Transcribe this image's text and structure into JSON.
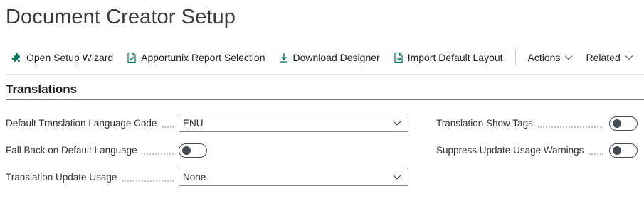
{
  "page": {
    "title": "Document Creator Setup"
  },
  "actionbar": {
    "items": [
      {
        "label": "Open Setup Wizard",
        "icon": "puzzle-icon"
      },
      {
        "label": "Apportunix Report Selection",
        "icon": "report-selection-icon"
      },
      {
        "label": "Download Designer",
        "icon": "download-icon"
      },
      {
        "label": "Import Default Layout",
        "icon": "import-file-icon"
      }
    ],
    "menus": [
      {
        "label": "Actions"
      },
      {
        "label": "Related"
      }
    ]
  },
  "section": {
    "title": "Translations"
  },
  "fields": {
    "default_translation_language_code": {
      "label": "Default Translation Language Code",
      "value": "ENU"
    },
    "fall_back_on_default_language": {
      "label": "Fall Back on Default Language",
      "value": false
    },
    "translation_update_usage": {
      "label": "Translation Update Usage",
      "value": "None"
    },
    "translation_show_tags": {
      "label": "Translation Show Tags",
      "value": false
    },
    "suppress_update_usage_warnings": {
      "label": "Suppress Update Usage Warnings",
      "value": false
    }
  },
  "colors": {
    "accent": "#00735c",
    "toggle_off": "#444c56"
  }
}
